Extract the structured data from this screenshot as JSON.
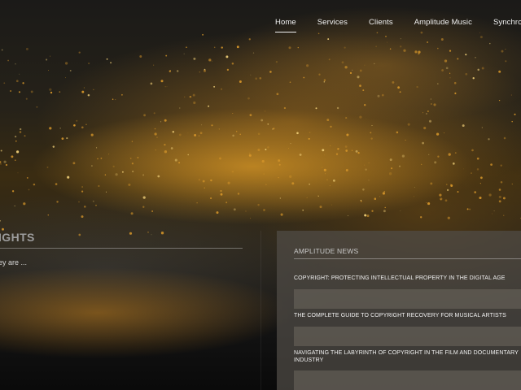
{
  "nav": {
    "items": [
      {
        "label": "Home",
        "active": true
      },
      {
        "label": "Services",
        "active": false
      },
      {
        "label": "Clients",
        "active": false
      },
      {
        "label": "Amplitude Music",
        "active": false
      },
      {
        "label": "Synchron",
        "active": false
      }
    ]
  },
  "hero": {
    "title_fragment": "IGHTS",
    "subtitle_fragment": "ey are ..."
  },
  "news": {
    "heading": "AMPLITUDE NEWS",
    "items": [
      {
        "title": "COPYRIGHT: PROTECTING INTELLECTUAL PROPERTY IN THE DIGITAL AGE"
      },
      {
        "title": "THE COMPLETE GUIDE TO COPYRIGHT RECOVERY FOR MUSICAL ARTISTS"
      },
      {
        "title": "NAVIGATING THE LABYRINTH OF COPYRIGHT IN THE FILM AND DOCUMENTARY INDUSTRY"
      }
    ]
  },
  "colors": {
    "accent_gold": "#d6962a",
    "panel": "#504c46",
    "text_light": "#f2f2f2"
  }
}
